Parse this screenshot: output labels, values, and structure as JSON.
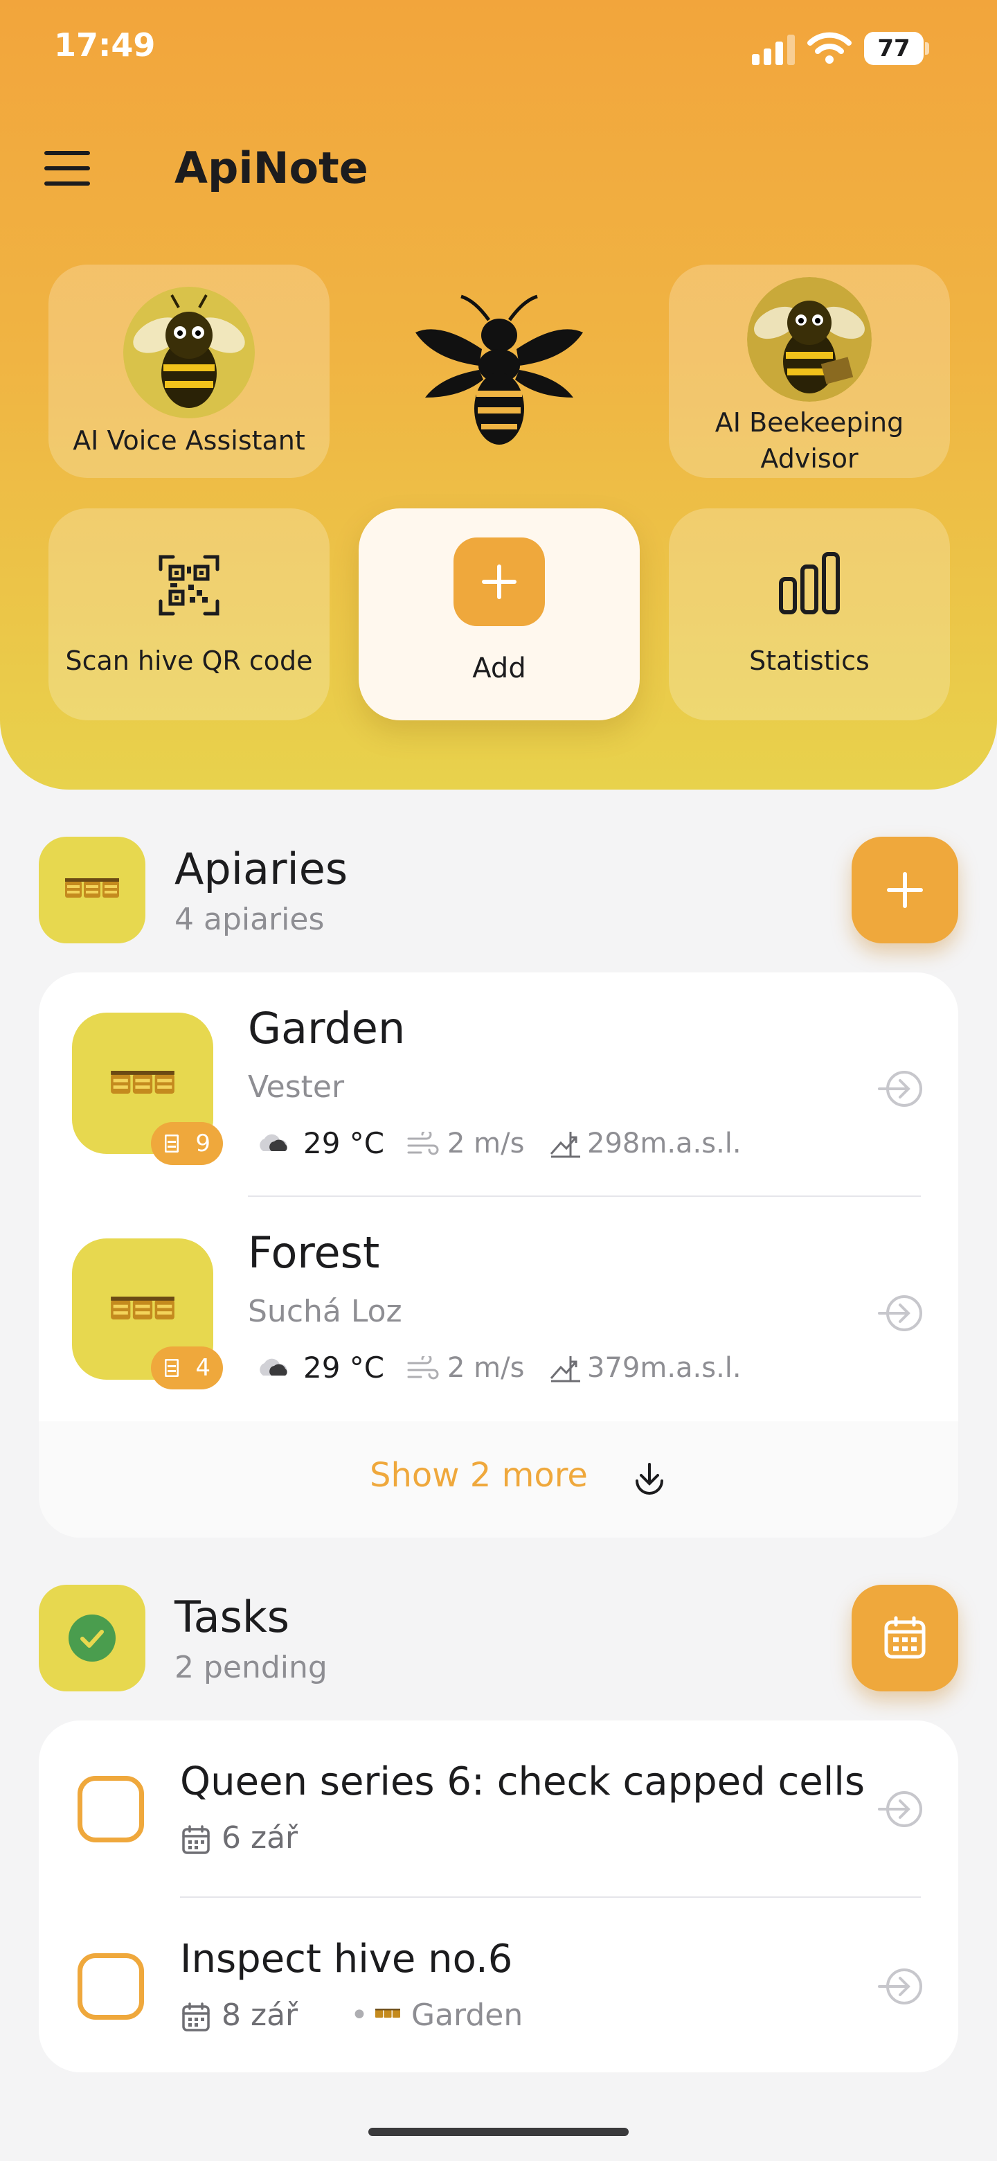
{
  "status_bar": {
    "time": "17:49",
    "battery": "77"
  },
  "header": {
    "title": "ApiNote"
  },
  "quick_actions": {
    "voice_assistant": "AI Voice Assistant",
    "advisor_line1": "AI Beekeeping",
    "advisor_line2": "Advisor",
    "scan_qr": "Scan hive QR code",
    "add": "Add",
    "statistics": "Statistics"
  },
  "apiaries": {
    "title": "Apiaries",
    "subtitle": "4 apiaries",
    "items": [
      {
        "name": "Garden",
        "location": "Vester",
        "hives": "9",
        "temperature": "29 °C",
        "wind": "2 m/s",
        "altitude": "298m.a.s.l."
      },
      {
        "name": "Forest",
        "location": "Suchá Loz",
        "hives": "4",
        "temperature": "29 °C",
        "wind": "2 m/s",
        "altitude": "379m.a.s.l."
      }
    ],
    "show_more": "Show 2 more"
  },
  "tasks": {
    "title": "Tasks",
    "subtitle": "2 pending",
    "items": [
      {
        "title": "Queen series 6: check capped cells",
        "date": "6 zář"
      },
      {
        "title": "Inspect hive no.6",
        "date": "8 zář",
        "separator": "•",
        "apiary": "Garden"
      }
    ]
  },
  "colors": {
    "accent": "#efa83c",
    "section_icon": "#e7d84f",
    "muted_text": "#8e8e93"
  }
}
